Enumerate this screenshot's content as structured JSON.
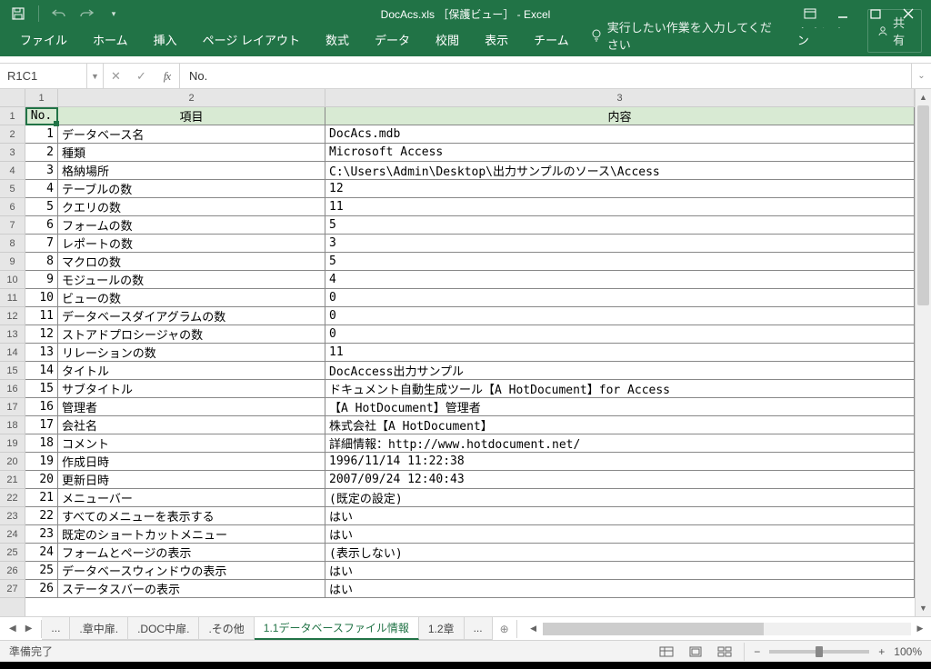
{
  "window": {
    "title": "DocAcs.xls ［保護ビュー］ - Excel"
  },
  "ribbon": {
    "tabs": [
      "ファイル",
      "ホーム",
      "挿入",
      "ページ レイアウト",
      "数式",
      "データ",
      "校閲",
      "表示",
      "チーム"
    ],
    "tell_me": "実行したい作業を入力してください",
    "signin": "サインイン",
    "share": "共有"
  },
  "formula": {
    "name_box": "R1C1",
    "value": "No."
  },
  "col_labels": [
    "1",
    "2",
    "3"
  ],
  "header": {
    "no": "No.",
    "item": "項目",
    "val": "内容"
  },
  "rows": [
    {
      "n": "1",
      "i": "データベース名",
      "v": "DocAcs.mdb"
    },
    {
      "n": "2",
      "i": "種類",
      "v": "Microsoft Access"
    },
    {
      "n": "3",
      "i": "格納場所",
      "v": "C:\\Users\\Admin\\Desktop\\出力サンプルのソース\\Access"
    },
    {
      "n": "4",
      "i": "テーブルの数",
      "v": "12"
    },
    {
      "n": "5",
      "i": "クエリの数",
      "v": "11"
    },
    {
      "n": "6",
      "i": "フォームの数",
      "v": "5"
    },
    {
      "n": "7",
      "i": "レポートの数",
      "v": "3"
    },
    {
      "n": "8",
      "i": "マクロの数",
      "v": "5"
    },
    {
      "n": "9",
      "i": "モジュールの数",
      "v": "4"
    },
    {
      "n": "10",
      "i": "ビューの数",
      "v": "0"
    },
    {
      "n": "11",
      "i": "データベースダイアグラムの数",
      "v": "0"
    },
    {
      "n": "12",
      "i": "ストアドプロシージャの数",
      "v": "0"
    },
    {
      "n": "13",
      "i": "リレーションの数",
      "v": "11"
    },
    {
      "n": "14",
      "i": "タイトル",
      "v": "DocAccess出力サンプル"
    },
    {
      "n": "15",
      "i": "サブタイトル",
      "v": "ドキュメント自動生成ツール【A HotDocument】for Access"
    },
    {
      "n": "16",
      "i": "管理者",
      "v": "【A HotDocument】管理者"
    },
    {
      "n": "17",
      "i": "会社名",
      "v": "株式会社【A HotDocument】"
    },
    {
      "n": "18",
      "i": "コメント",
      "v": "詳細情報：http://www.hotdocument.net/"
    },
    {
      "n": "19",
      "i": "作成日時",
      "v": "1996/11/14 11:22:38"
    },
    {
      "n": "20",
      "i": "更新日時",
      "v": "2007/09/24 12:40:43"
    },
    {
      "n": "21",
      "i": "メニューバー",
      "v": "(既定の設定)"
    },
    {
      "n": "22",
      "i": "すべてのメニューを表示する",
      "v": "はい"
    },
    {
      "n": "23",
      "i": "既定のショートカットメニュー",
      "v": "はい"
    },
    {
      "n": "24",
      "i": "フォームとページの表示",
      "v": "(表示しない)"
    },
    {
      "n": "25",
      "i": "データベースウィンドウの表示",
      "v": "はい"
    },
    {
      "n": "26",
      "i": "ステータスバーの表示",
      "v": "はい"
    }
  ],
  "row_nums": [
    "1",
    "2",
    "3",
    "4",
    "5",
    "6",
    "7",
    "8",
    "9",
    "10",
    "11",
    "12",
    "13",
    "14",
    "15",
    "16",
    "17",
    "18",
    "19",
    "20",
    "21",
    "22",
    "23",
    "24",
    "25",
    "26",
    "27"
  ],
  "sheets": {
    "overflow": "...",
    "tabs": [
      ".章中扉.",
      ".DOC中扉.",
      ".その他"
    ],
    "active": "1.1データベースファイル情報",
    "after": "1.2章",
    "after_overflow": "..."
  },
  "status": {
    "ready": "準備完了",
    "zoom": "100%"
  }
}
